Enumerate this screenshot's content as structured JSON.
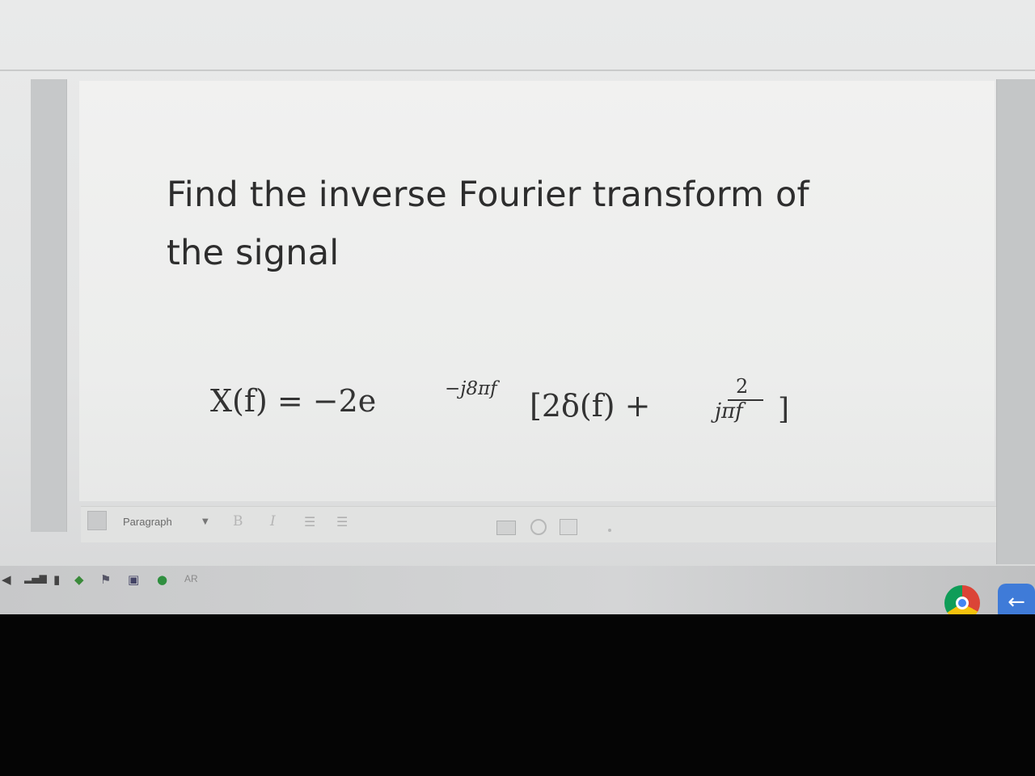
{
  "question": {
    "line1": "Find the inverse Fourier transform of",
    "line2": "the signal"
  },
  "formula": {
    "lhs": "X(f) = −2e",
    "exponent": "−j8πf",
    "bracket_part": "[2δ(f) +",
    "fraction_numerator": "2",
    "fraction_denominator": "jπf",
    "close": "]"
  },
  "toolbar": {
    "format_select": "Paragraph",
    "bold_label": "B",
    "italic_label": "I",
    "bullet_list_icon": "bullet-list-icon",
    "numbered_list_icon": "numbered-list-icon",
    "image_icon": "image-icon",
    "emoji_icon": "emoji-icon",
    "media_icon": "media-icon"
  },
  "taskbar": {
    "language": "AR",
    "tray_icons": [
      "volume-icon",
      "signal-icon",
      "battery-icon",
      "network-icon",
      "flag-icon",
      "monitor-icon",
      "google-icon"
    ],
    "apps": [
      "chrome-icon",
      "back-arrow-icon"
    ]
  }
}
